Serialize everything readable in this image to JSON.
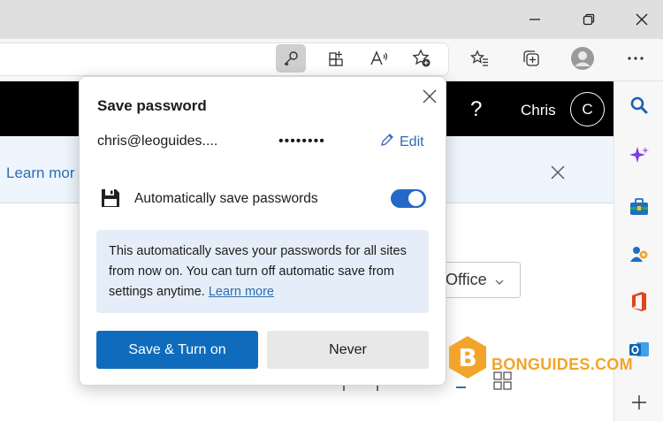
{
  "page": {
    "header": {
      "help": "?",
      "user_name": "Chris",
      "user_initial": "C"
    },
    "banner": {
      "learn_more": "Learn mor"
    },
    "office_button": "Office"
  },
  "popup": {
    "title": "Save password",
    "username": "chris@leoguides....",
    "password_mask": "••••••••",
    "edit": "Edit",
    "auto_save_label": "Automatically save passwords",
    "auto_save_on": true,
    "info_text": "This automatically saves your passwords for all sites from now on. You can turn off automatic save from settings anytime.",
    "info_link": "Learn more",
    "save_button": "Save & Turn on",
    "never_button": "Never"
  },
  "icons": {
    "window": [
      "minimize-icon",
      "restore-icon",
      "close-icon"
    ],
    "toolbar": [
      "key-icon",
      "apps-icon",
      "read-aloud-icon",
      "add-favorite-icon",
      "favorites-icon",
      "collections-icon",
      "profile-icon",
      "more-icon"
    ],
    "sidebar": [
      "search-icon",
      "copilot-icon",
      "tools-icon",
      "people-icon",
      "office-icon",
      "outlook-icon",
      "add-icon"
    ]
  },
  "colors": {
    "accent": "#0f6cbd",
    "link": "#2f6cb2",
    "toggle_on": "#2468c8",
    "info_bg": "#e5eef8",
    "header_bg": "#000000"
  },
  "watermark": {
    "text": "BONGUIDES.COM",
    "logo_letter": "B"
  }
}
